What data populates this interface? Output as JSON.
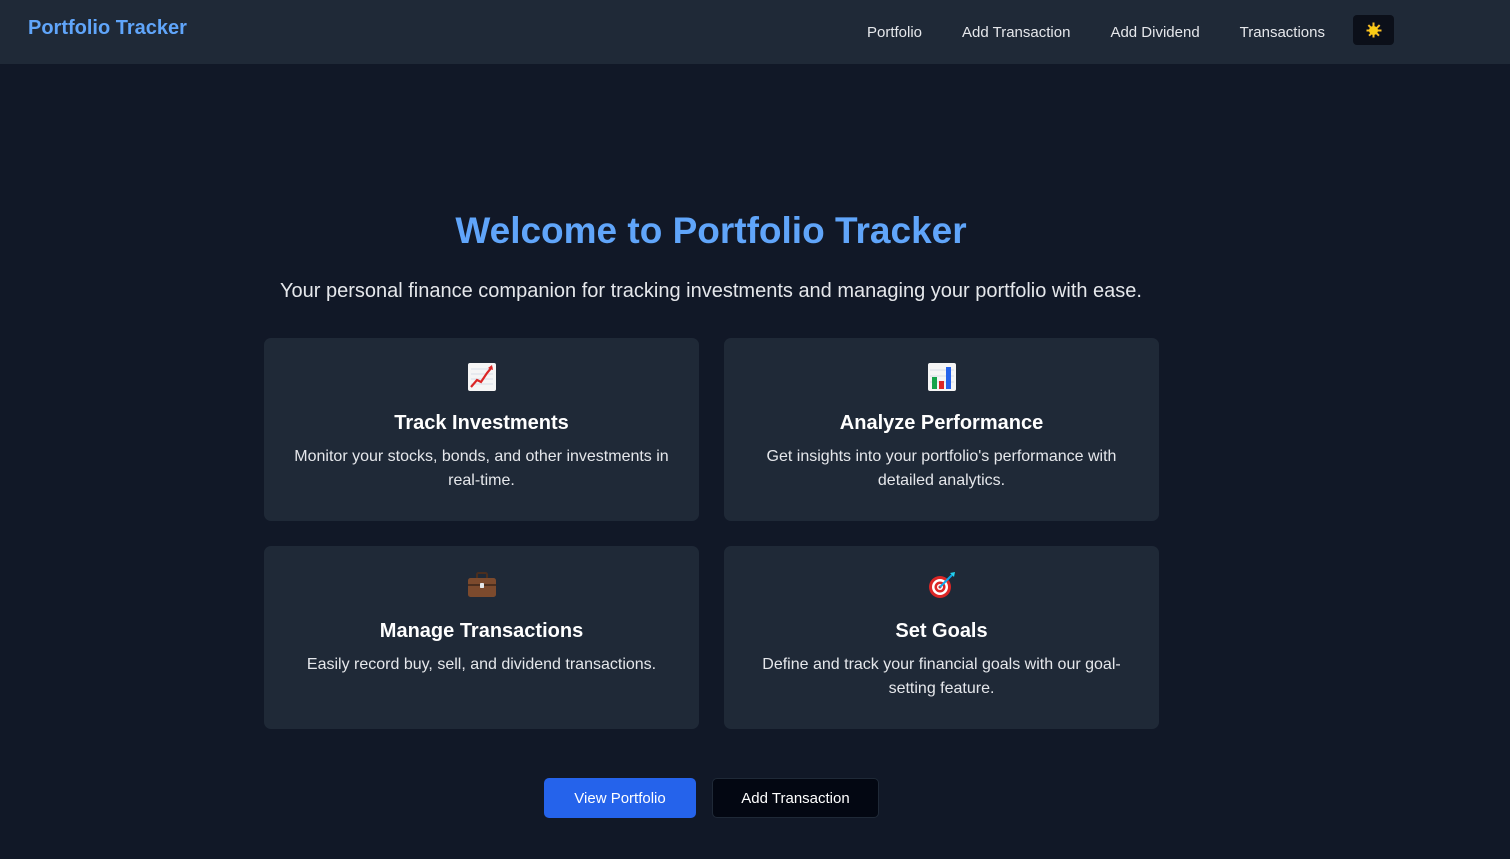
{
  "app": {
    "brand": "Portfolio Tracker"
  },
  "nav": {
    "items": [
      {
        "label": "Portfolio"
      },
      {
        "label": "Add Transaction"
      },
      {
        "label": "Add Dividend"
      },
      {
        "label": "Transactions"
      }
    ],
    "theme_toggle_icon": "sun-icon"
  },
  "hero": {
    "title": "Welcome to Portfolio Tracker",
    "subtitle": "Your personal finance companion for tracking investments and managing your portfolio with ease."
  },
  "features": [
    {
      "icon": "chart-increasing-icon",
      "title": "Track Investments",
      "description": "Monitor your stocks, bonds, and other investments in real-time."
    },
    {
      "icon": "bar-chart-icon",
      "title": "Analyze Performance",
      "description": "Get insights into your portfolio's performance with detailed analytics."
    },
    {
      "icon": "briefcase-icon",
      "title": "Manage Transactions",
      "description": "Easily record buy, sell, and dividend transactions."
    },
    {
      "icon": "target-icon",
      "title": "Set Goals",
      "description": "Define and track your financial goals with our goal-setting feature."
    }
  ],
  "actions": {
    "primary_label": "View Portfolio",
    "secondary_label": "Add Transaction"
  },
  "colors": {
    "background": "#111827",
    "surface": "#1f2937",
    "accent": "#60a5fa",
    "primary_button": "#2563eb"
  }
}
